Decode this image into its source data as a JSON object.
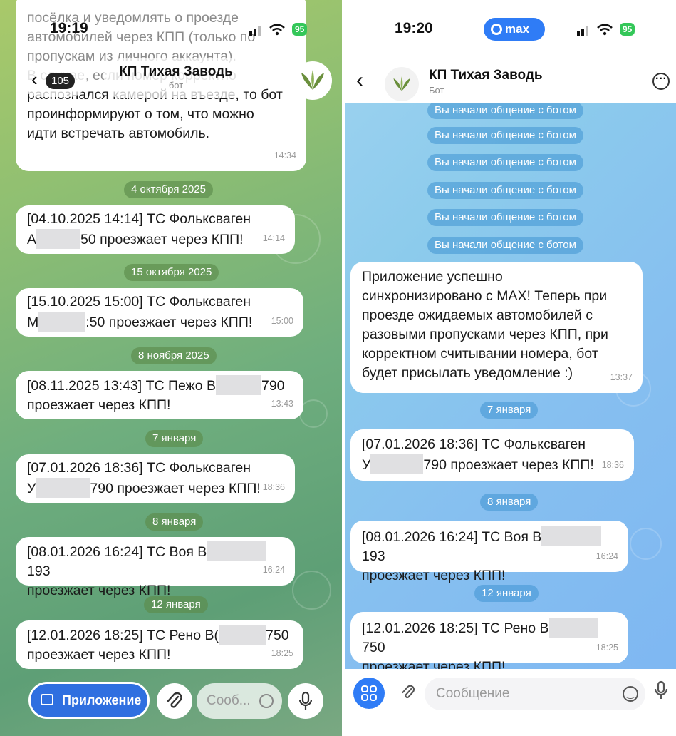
{
  "left": {
    "status": {
      "time": "19:19",
      "battery": "95"
    },
    "header": {
      "back_count": "105",
      "title": "КП Тихая Заводь",
      "subtitle": "бот"
    },
    "top_text": {
      "line1": "посёлка и уведомлять о проезде",
      "line2": "автомобилей через КПП (только по",
      "line3": "пропускам из личного аккаунта)."
    },
    "intro_bubble": {
      "line1": "В случае, если номер корректно",
      "line2": "распознался камерой на въезде, то бот",
      "line3": "проинформируют о том, что можно",
      "line4": "идти встречать автомобиль.",
      "time": "14:34"
    },
    "dates": [
      "4 октября 2025",
      "15 октября 2025",
      "8 ноября 2025",
      "7 января",
      "8 января",
      "12 января"
    ],
    "messages": [
      {
        "line1": "[04.10.2025 14:14] ТС Фольксваген",
        "pre": "А",
        "post": "50 проезжает через КПП!",
        "time": "14:14"
      },
      {
        "line1": "[15.10.2025 15:00] ТС Фольксваген",
        "pre": "М",
        "post": ":50 проезжает через КПП!",
        "time": "15:00"
      },
      {
        "pre": "[08.11.2025 13:43] ТС Пежо В",
        "post": "790",
        "line2": "проезжает через КПП!",
        "time": "13:43"
      },
      {
        "line1": "[07.01.2026 18:36] ТС Фольксваген",
        "pre": "У",
        "post": "790 проезжает через КПП!",
        "time": "18:36"
      },
      {
        "pre": "[08.01.2026 16:24] ТС Воя В",
        "post": "193",
        "line2": "проезжает через КПП!",
        "time": "16:24"
      },
      {
        "pre": "[12.01.2026 18:25] ТС Рено В(",
        "post": "750",
        "line2": "проезжает через КПП!",
        "time": "18:25"
      }
    ],
    "bottom": {
      "app_button": "Приложение",
      "message_placeholder": "Сооб..."
    }
  },
  "right": {
    "status": {
      "time": "19:20",
      "battery": "95",
      "badge": "max"
    },
    "header": {
      "title": "КП Тихая Заводь",
      "subtitle": "Бот"
    },
    "service_pills": [
      "Вы начали общение с ботом",
      "Вы начали общение с ботом",
      "Вы начали общение с ботом",
      "Вы начали общение с ботом",
      "Вы начали общение с ботом",
      "Вы начали общение с ботом"
    ],
    "sync_bubble": {
      "line1": "Приложение успешно",
      "line2": "синхронизировано с MAX! Теперь при",
      "line3": "проезде ожидаемых автомобилей с",
      "line4": "разовыми пропусками через КПП, при",
      "line5": "корректном считывании номера, бот",
      "line6": "будет присылать уведомление :)",
      "time": "13:37"
    },
    "dates": [
      "7 января",
      "8 января",
      "12 января"
    ],
    "messages": [
      {
        "line1": "[07.01.2026 18:36] ТС Фольксваген",
        "pre": "У",
        "post": "790 проезжает через КПП!",
        "time": "18:36"
      },
      {
        "pre": "[08.01.2026 16:24] ТС Воя В",
        "post": "193",
        "line2": "проезжает через КПП!",
        "time": "16:24"
      },
      {
        "pre": "[12.01.2026 18:25] ТС Рено В",
        "post": "750",
        "line2": "проезжает через КПП!",
        "time": "18:25"
      }
    ],
    "bottom": {
      "message_placeholder": "Сообщение"
    }
  }
}
